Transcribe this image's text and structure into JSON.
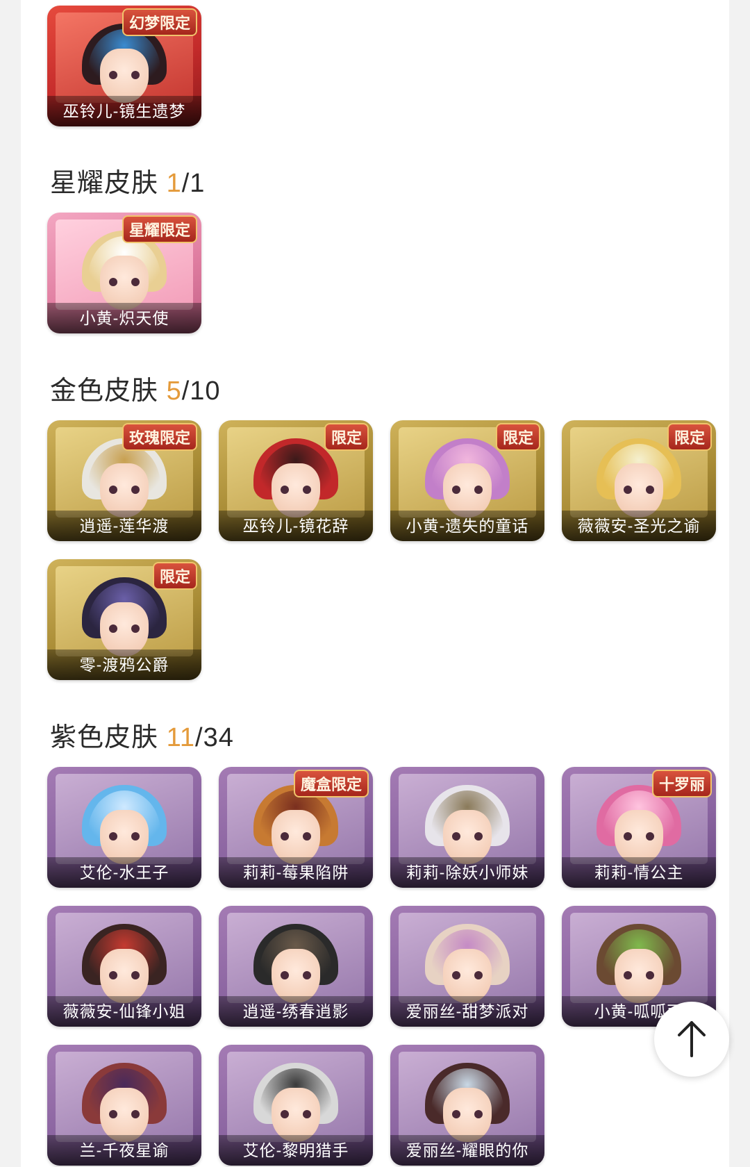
{
  "sections": [
    {
      "title": "",
      "owned": "",
      "total": "",
      "items": [
        {
          "name": "巫铃儿-镜生遗梦",
          "badge": "幻梦限定",
          "hair": "#2d1b1f",
          "accent": "#3a8bd0"
        }
      ]
    },
    {
      "title": "星耀皮肤",
      "owned": "1",
      "total": "1",
      "items": [
        {
          "name": "小黄-炽天使",
          "badge": "星耀限定",
          "hair": "#e9cf93",
          "accent": "#ffffff"
        }
      ]
    },
    {
      "title": "金色皮肤",
      "owned": "5",
      "total": "10",
      "items": [
        {
          "name": "逍遥-莲华渡",
          "badge": "玫瑰限定",
          "hair": "#e8e6e0",
          "accent": "#c8a050"
        },
        {
          "name": "巫铃儿-镜花辞",
          "badge": "限定",
          "hair": "#c2282a",
          "accent": "#3a1a1a"
        },
        {
          "name": "小黄-遗失的童话",
          "badge": "限定",
          "hair": "#c27fc9",
          "accent": "#f1b6dd"
        },
        {
          "name": "薇薇安-圣光之谕",
          "badge": "限定",
          "hair": "#e6bf55",
          "accent": "#f5f0d0"
        },
        {
          "name": "零-渡鸦公爵",
          "badge": "限定",
          "hair": "#2b2540",
          "accent": "#6a5fa8"
        }
      ]
    },
    {
      "title": "紫色皮肤",
      "owned": "11",
      "total": "34",
      "items": [
        {
          "name": "艾伦-水王子",
          "badge": "",
          "hair": "#64b6ec",
          "accent": "#cfe9ff"
        },
        {
          "name": "莉莉-莓果陷阱",
          "badge": "魔盒限定",
          "hair": "#c77a32",
          "accent": "#7a2f1f"
        },
        {
          "name": "莉莉-除妖小师妹",
          "badge": "",
          "hair": "#e7e4ea",
          "accent": "#8a7a5a"
        },
        {
          "name": "莉莉-情公主",
          "badge": "十罗丽",
          "hair": "#e06ba2",
          "accent": "#ffc4df"
        },
        {
          "name": "薇薇安-仙锋小姐",
          "badge": "",
          "hair": "#3a2422",
          "accent": "#c43a30"
        },
        {
          "name": "逍遥-绣春逍影",
          "badge": "",
          "hair": "#2a2a2a",
          "accent": "#6a5a4a"
        },
        {
          "name": "爱丽丝-甜梦派对",
          "badge": "",
          "hair": "#e7d2c3",
          "accent": "#c58bc5"
        },
        {
          "name": "小黄-呱呱雨",
          "badge": "",
          "hair": "#6b4a32",
          "accent": "#7fb94d"
        },
        {
          "name": "兰-千夜星谕",
          "badge": "",
          "hair": "#8a3a3a",
          "accent": "#4a2a5a"
        },
        {
          "name": "艾伦-黎明猎手",
          "badge": "",
          "hair": "#d8d8d8",
          "accent": "#3a3a3a"
        },
        {
          "name": "爱丽丝-耀眼的你",
          "badge": "",
          "hair": "#4a2a2a",
          "accent": "#c9d8e5"
        }
      ]
    }
  ],
  "scroll_top_icon": "arrow-up-icon"
}
